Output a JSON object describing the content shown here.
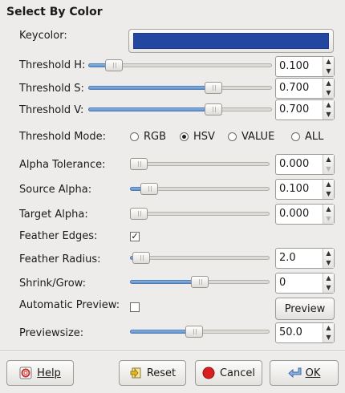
{
  "dialog": {
    "title": "Select By Color"
  },
  "keycolor": {
    "label": "Keycolor:",
    "color": "#2346a0"
  },
  "threshold_h": {
    "label": "Threshold H:",
    "value": "0.100",
    "fraction": 0.1
  },
  "threshold_s": {
    "label": "Threshold S:",
    "value": "0.700",
    "fraction": 0.7
  },
  "threshold_v": {
    "label": "Threshold V:",
    "value": "0.700",
    "fraction": 0.7
  },
  "threshold_mode": {
    "label": "Threshold Mode:",
    "options": [
      "RGB",
      "HSV",
      "VALUE",
      "ALL"
    ],
    "selected": "HSV"
  },
  "alpha_tolerance": {
    "label": "Alpha Tolerance:",
    "value": "0.000",
    "fraction": 0.0
  },
  "source_alpha": {
    "label": "Source Alpha:",
    "value": "0.100",
    "fraction": 0.1
  },
  "target_alpha": {
    "label": "Target Alpha:",
    "value": "0.000",
    "fraction": 0.0
  },
  "feather_edges": {
    "label": "Feather Edges:",
    "checked": true
  },
  "feather_radius": {
    "label": "Feather Radius:",
    "value": "2.0"
  },
  "shrink_grow": {
    "label": "Shrink/Grow:",
    "value": "0"
  },
  "automatic_preview": {
    "label": "Automatic Preview:",
    "checked": false,
    "button": "Preview"
  },
  "previewsize": {
    "label": "Previewsize:",
    "value": "50.0"
  },
  "buttons": {
    "help": "Help",
    "reset": "Reset",
    "cancel": "Cancel",
    "ok": "OK"
  },
  "colors": {
    "accent": "#5f8fc9",
    "background": "#edeceb"
  }
}
